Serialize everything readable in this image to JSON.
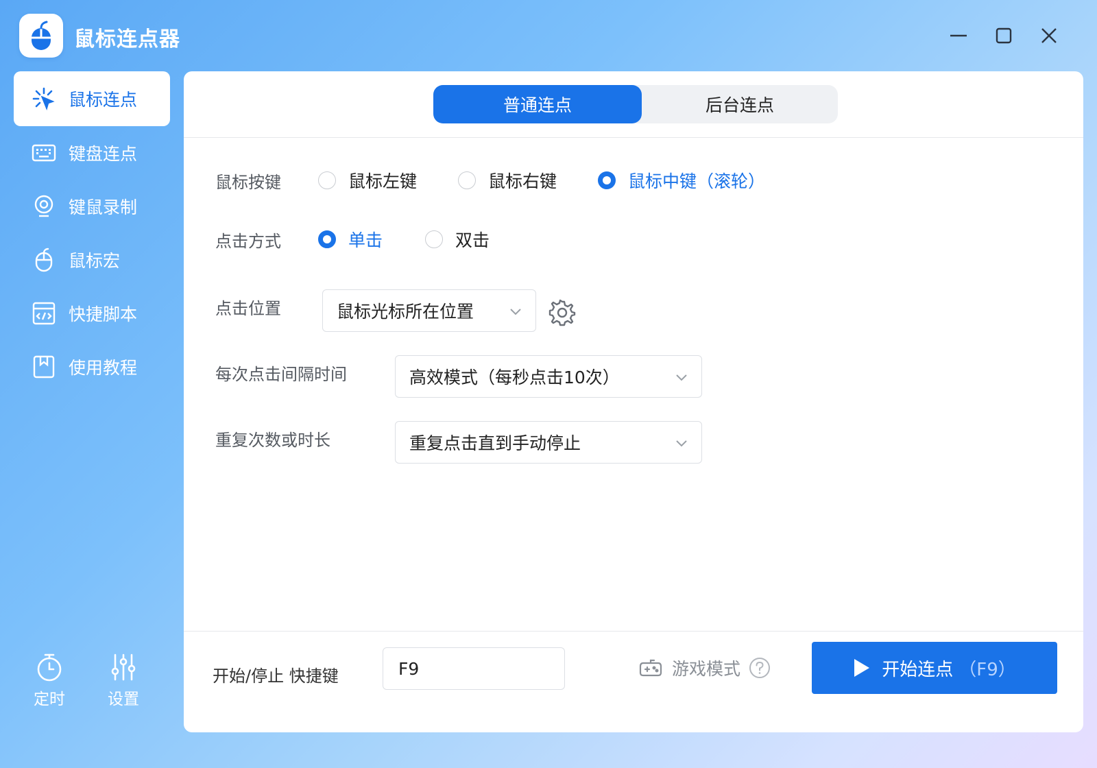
{
  "app": {
    "title": "鼠标连点器"
  },
  "window_controls": [
    "minimize",
    "maximize",
    "close"
  ],
  "sidebar": {
    "items": [
      {
        "label": "鼠标连点",
        "icon": "mouse-click-icon",
        "active": true
      },
      {
        "label": "键盘连点",
        "icon": "keyboard-icon",
        "active": false
      },
      {
        "label": "键鼠录制",
        "icon": "webcam-record-icon",
        "active": false
      },
      {
        "label": "鼠标宏",
        "icon": "mouse-icon",
        "active": false
      },
      {
        "label": "快捷脚本",
        "icon": "script-icon",
        "active": false
      },
      {
        "label": "使用教程",
        "icon": "bookmark-icon",
        "active": false
      }
    ],
    "bottom": [
      {
        "label": "定时",
        "icon": "timer-icon"
      },
      {
        "label": "设置",
        "icon": "sliders-icon"
      }
    ]
  },
  "tabs": [
    {
      "label": "普通连点",
      "active": true
    },
    {
      "label": "后台连点",
      "active": false
    }
  ],
  "form": {
    "mouse_button": {
      "label": "鼠标按键",
      "options": [
        "鼠标左键",
        "鼠标右键",
        "鼠标中键（滚轮）"
      ],
      "selected": "鼠标中键（滚轮）"
    },
    "click_type": {
      "label": "点击方式",
      "options": [
        "单击",
        "双击"
      ],
      "selected": "单击"
    },
    "click_position": {
      "label": "点击位置",
      "value": "鼠标光标所在位置"
    },
    "interval": {
      "label": "每次点击间隔时间",
      "value": "高效模式（每秒点击10次）"
    },
    "repeat": {
      "label": "重复次数或时长",
      "value": "重复点击直到手动停止"
    }
  },
  "footer": {
    "hotkey_label": "开始/停止 快捷键",
    "hotkey_value": "F9",
    "game_mode_label": "游戏模式",
    "start_label": "开始连点",
    "start_key": "（F9）"
  },
  "colors": {
    "accent": "#1a73e8",
    "background_start": "#5aa8f5",
    "background_end": "#e7ddff"
  }
}
